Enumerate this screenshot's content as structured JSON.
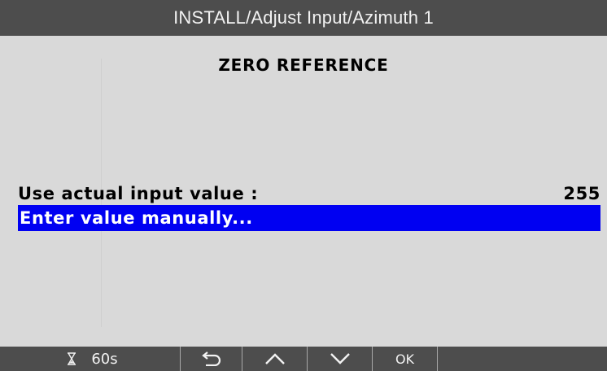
{
  "window": {
    "title": "INSTALL/Adjust Input/Azimuth 1"
  },
  "main": {
    "heading": "ZERO REFERENCE",
    "options": [
      {
        "label": "Use actual input value :",
        "value": "255",
        "selected": false
      },
      {
        "label": "Enter value manually...",
        "selected": true
      }
    ]
  },
  "toolbar": {
    "timer_label": "60s",
    "ok_label": "OK",
    "icons": [
      "hourglass-icon",
      "back-arrow-icon",
      "chevron-up-icon",
      "chevron-down-icon"
    ]
  },
  "colors": {
    "titlebar_bg": "#4d4d4d",
    "content_bg": "#d9d9d9",
    "selection_bg": "#0000f2",
    "text": "#000000",
    "bar_text": "#f2f2f2"
  }
}
